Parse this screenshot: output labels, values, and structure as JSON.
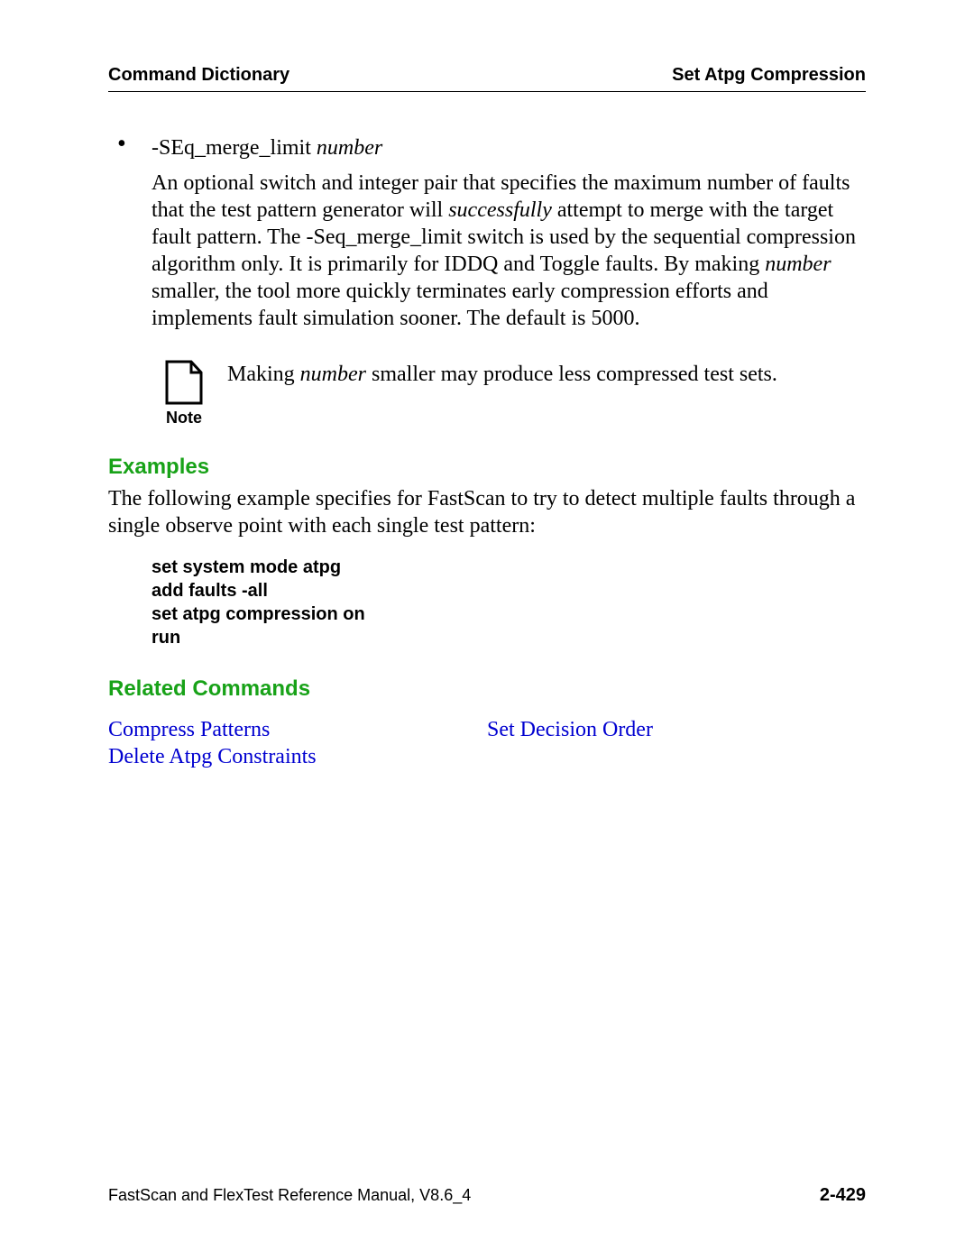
{
  "header": {
    "left": "Command Dictionary",
    "right": "Set Atpg Compression"
  },
  "bullet": {
    "switch": "-SEq_merge_limit ",
    "arg": "number"
  },
  "para1": {
    "t1": "An optional switch and integer pair that specifies the maximum number of faults that the test pattern generator will ",
    "em1": "successfully",
    "t2": " attempt to merge with the target fault pattern. The -Seq_merge_limit switch is used by the sequential compression algorithm only. It is primarily for IDDQ and Toggle faults. By making ",
    "em2": "number",
    "t3": " smaller, the tool more quickly terminates early compression efforts and implements fault simulation sooner. The default is 5000."
  },
  "note": {
    "label": "Note",
    "t1": "Making ",
    "em": "number",
    "t2": " smaller may produce less compressed test sets."
  },
  "sections": {
    "examples": "Examples",
    "related": "Related Commands"
  },
  "examples_intro": "The following example specifies for FastScan to try to detect multiple faults through a single observe point with each single test pattern:",
  "code": "set system mode atpg\nadd faults -all\nset atpg compression on\nrun",
  "related": {
    "col1": [
      "Compress Patterns",
      "Delete Atpg Constraints"
    ],
    "col2": [
      "Set Decision Order"
    ]
  },
  "footer": {
    "left": "FastScan and FlexTest Reference Manual, V8.6_4",
    "right": "2-429"
  }
}
